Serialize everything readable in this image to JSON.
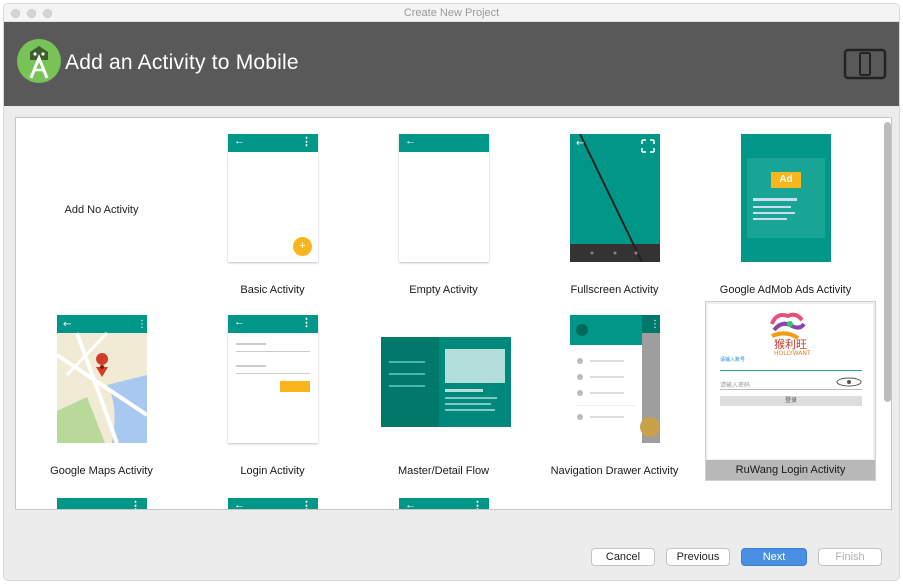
{
  "window": {
    "title": "Create New Project"
  },
  "header": {
    "title": "Add an Activity to Mobile",
    "logo_icon": "android-studio-logo-icon",
    "device_icon": "tablet-device-icon"
  },
  "gallery": {
    "tiles": [
      {
        "label": "Add No Activity"
      },
      {
        "label": "Basic Activity"
      },
      {
        "label": "Empty Activity"
      },
      {
        "label": "Fullscreen Activity"
      },
      {
        "label": "Google AdMob Ads Activity",
        "ad_badge": "Ad"
      },
      {
        "label": "Google Maps Activity"
      },
      {
        "label": "Login Activity"
      },
      {
        "label": "Master/Detail Flow"
      },
      {
        "label": "Navigation Drawer Activity"
      },
      {
        "label": "RuWang Login Activity",
        "selected": true
      }
    ],
    "ruwang_preview": {
      "brand_cn": "猴利旺",
      "brand_en": "HOLLYWANT",
      "field1_hint": "请输入账号",
      "field2_hint": "请输入密码",
      "login_button": "登录"
    }
  },
  "footer": {
    "cancel": "Cancel",
    "previous": "Previous",
    "next": "Next",
    "finish": "Finish"
  },
  "colors": {
    "accent_teal": "#009688",
    "fab_yellow": "#f9b51c",
    "header_gray": "#595959",
    "next_blue": "#4a90e2"
  }
}
